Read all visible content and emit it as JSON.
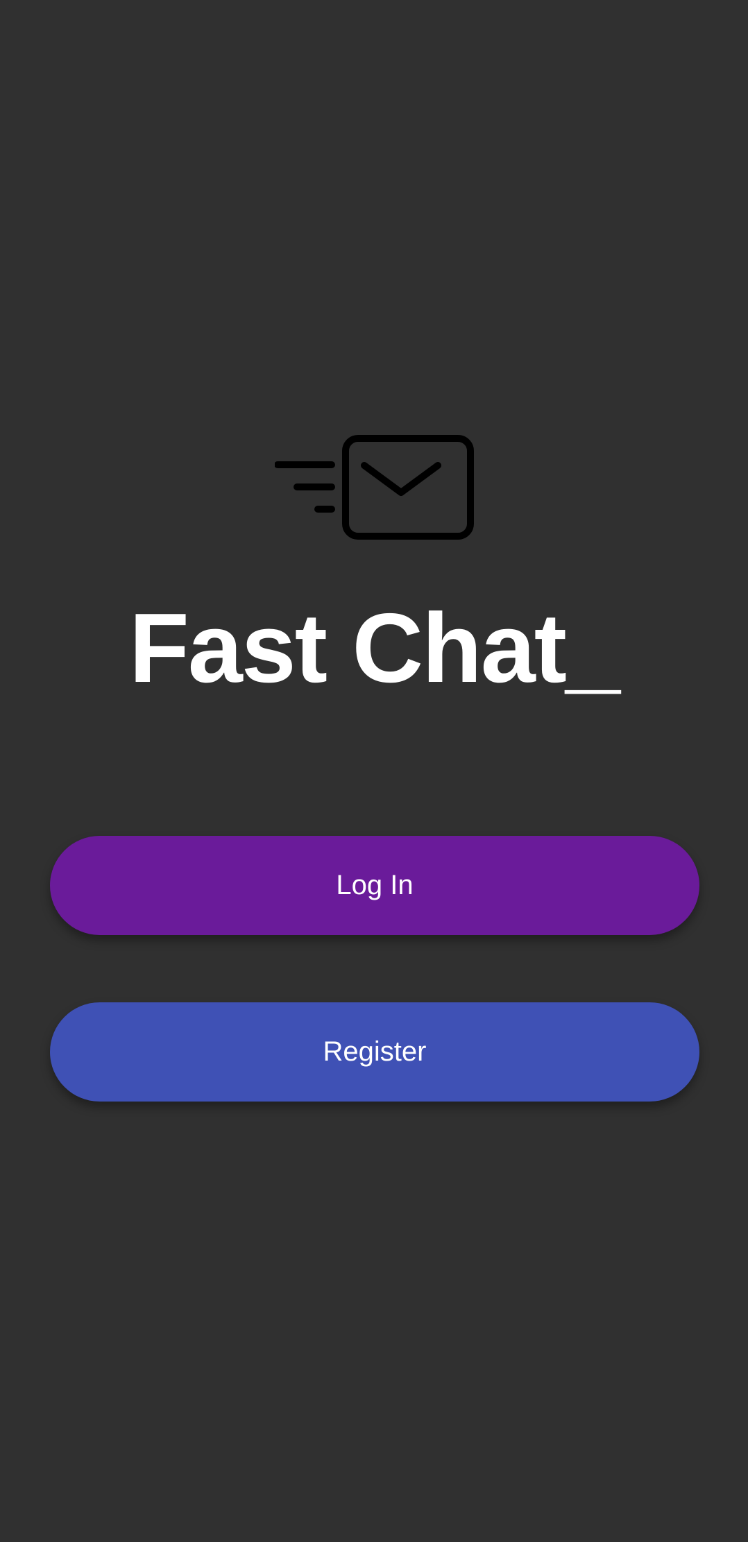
{
  "app": {
    "title": "Fast Chat_",
    "logo_icon": "fast-mail-icon"
  },
  "actions": {
    "login_label": "Log In",
    "register_label": "Register"
  },
  "colors": {
    "background": "#303030",
    "title_text": "#ffffff",
    "icon_stroke": "#000000",
    "login_button": "#6a1b9a",
    "register_button": "#3f51b5",
    "button_text": "#ffffff"
  }
}
